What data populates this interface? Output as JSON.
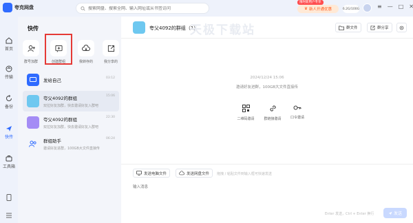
{
  "app": {
    "name": "夸克网盘"
  },
  "search": {
    "placeholder": "搜索网盘、搜索全网、输入网址或从书签访问"
  },
  "promo": {
    "tag": "限时新用户专享",
    "label": "新人开通优惠"
  },
  "storage": {
    "label": "6.2G/100G"
  },
  "nav": [
    {
      "label": "首页"
    },
    {
      "label": "传输"
    },
    {
      "label": "备份"
    },
    {
      "label": "快传"
    },
    {
      "label": "工具箱"
    }
  ],
  "panel": {
    "title": "快传",
    "actions": [
      {
        "label": "群号加群"
      },
      {
        "label": "创建群组"
      },
      {
        "label": "我转存的"
      },
      {
        "label": "我分享的"
      }
    ]
  },
  "chats": [
    {
      "name": "发给自己",
      "time": "03:12",
      "sub": ""
    },
    {
      "name": "夸父4092的群组",
      "time": "15:06",
      "sub": "双拉好友加群，快去邀请好友入群吧"
    },
    {
      "name": "夸父4092的群组",
      "time": "22:30",
      "sub": "双拉好友加群，快去邀请好友入群吧"
    },
    {
      "name": "群组助手",
      "time": "06:24",
      "sub": "邀请好友进群，100GB大文件直接传"
    }
  ],
  "conversation": {
    "title": "夸父4092的群组（1）",
    "group_files": "群文件",
    "group_share": "群分享",
    "timestamp": "2024/12/24 15:06",
    "system_message": "邀请好友进群，100GB大文件直接传",
    "invite": [
      {
        "label": "二维码邀请"
      },
      {
        "label": "群链接邀请"
      },
      {
        "label": "口令邀请"
      }
    ]
  },
  "composer": {
    "send_pc_file": "发送电脑文件",
    "send_drive_file": "发送网盘文件",
    "drop_hint": "拖拽 / 粘贴文件到输入框可快速发送",
    "placeholder": "输入消息",
    "send_hint": "Enter 发送，Ctrl + Enter 换行",
    "send": "发送"
  },
  "watermark": "天极下载站",
  "colors": {
    "accent": "#2f6bff",
    "highlight": "#e53935",
    "promo": "#ff5a1f"
  }
}
